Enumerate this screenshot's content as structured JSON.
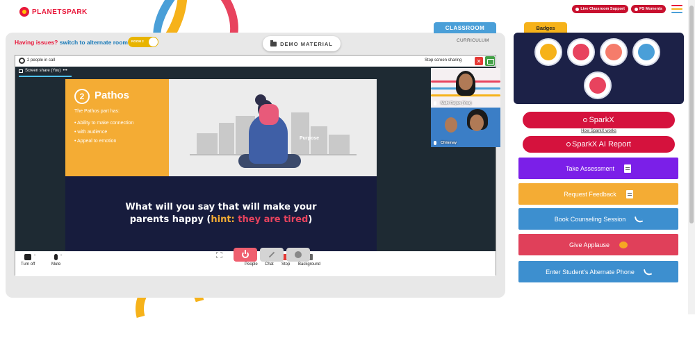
{
  "header": {
    "logo_text": "PLANETSPARK",
    "live_support_label": "Live Classroom Support",
    "ps_moments_label": "PS Moments",
    "menu_colors": [
      "#e8173a",
      "#f6b21a",
      "#4a9fd8"
    ]
  },
  "room": {
    "issue_question": "Having issues?",
    "switch_link": "switch to alternate room",
    "toggle_label": "ROOM 2",
    "demo_material_label": "DEMO MATERIAL",
    "curriculum_label": "CURRICULUM",
    "classroom_tab": "CLASSROOM"
  },
  "meeting": {
    "people_count": "2 people in call",
    "stop_sharing_label": "Stop screen sharing",
    "close_glyph": "✕",
    "screen_share_tab": "Screen share (You)",
    "tab_more": "•••",
    "participants": [
      {
        "name": "Mahi Rajan (You)"
      },
      {
        "name": "Chinmay"
      }
    ],
    "controls": {
      "turn_off": "Turn off",
      "mute": "Mute",
      "people": "People",
      "chat": "Chat",
      "stop": "Stop",
      "background": "Background"
    }
  },
  "slide": {
    "number": "2",
    "title": "Pathos",
    "subtitle": "The Pathos part has:",
    "points": [
      "Ability to make connection",
      "with audience",
      "Appeal to emotion"
    ],
    "image_caption": "Purpose",
    "question_part1": "What will you say that will make your",
    "question_part2": "parents happy (",
    "question_hint": "hint:",
    "question_tired": "they are tired",
    "question_close": ")"
  },
  "badges": {
    "title": "Badges",
    "items": [
      {
        "icon": "trophy-badge-icon",
        "color": "#f6b21a"
      },
      {
        "icon": "robot-badge-icon",
        "color": "#e8435e"
      },
      {
        "icon": "yoga-badge-icon",
        "color": "#f57c6b"
      },
      {
        "icon": "bulb-badge-icon",
        "color": "#4a9fd8"
      },
      {
        "icon": "trophy-stand-badge-icon",
        "color": "#e8435e"
      }
    ]
  },
  "sidebar": {
    "sparkx_label": "SparkX",
    "how_sparkx_link": "How SparkX works",
    "sparkx_report_label": "SparkX AI Report",
    "actions": [
      {
        "label": "Take Assessment",
        "color": "#7b1fe8",
        "icon": "clipboard-icon"
      },
      {
        "label": "Request Feedback",
        "color": "#f4ac34",
        "icon": "document-icon"
      },
      {
        "label": "Book Counseling Session",
        "color": "#3d8fcf",
        "icon": "phone-icon"
      },
      {
        "label": "Give Applause",
        "color": "#e0405a",
        "icon": "applause-icon"
      },
      {
        "label": "Enter Student's Alternate Phone",
        "color": "#3d8fcf",
        "icon": "phone-icon"
      }
    ]
  }
}
